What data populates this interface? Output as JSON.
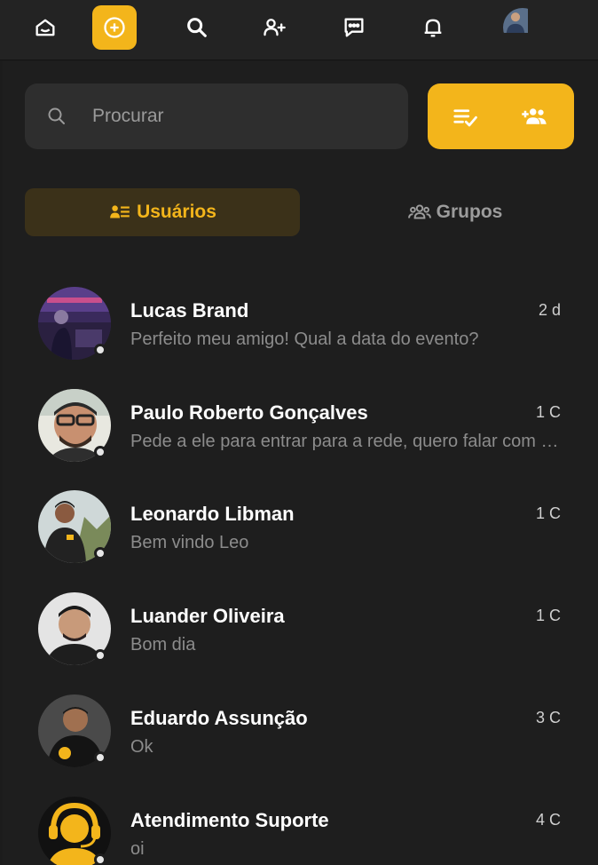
{
  "colors": {
    "accent": "#f3b51b",
    "background": "#1e1e1e",
    "topbar": "#232323",
    "muted_text": "#8c8c8c"
  },
  "topbar": {
    "items": [
      {
        "icon": "home-icon"
      },
      {
        "icon": "plus-circle-icon",
        "active": true
      },
      {
        "icon": "search-icon"
      },
      {
        "icon": "add-user-icon"
      },
      {
        "icon": "chat-icon"
      },
      {
        "icon": "bell-icon"
      },
      {
        "icon": "profile-avatar"
      }
    ]
  },
  "search": {
    "placeholder": "Procurar"
  },
  "actions": {
    "icons": [
      "mark-read-icon",
      "group-add-icon"
    ]
  },
  "tabs": [
    {
      "label": "Usuários",
      "icon": "users-list-icon",
      "active": true
    },
    {
      "label": "Grupos",
      "icon": "groups-icon",
      "active": false
    }
  ],
  "conversations": [
    {
      "name": "Lucas Brand",
      "time": "2 d",
      "preview": "Perfeito meu amigo! Qual a data do evento?"
    },
    {
      "name": "Paulo Roberto Gonçalves",
      "time": "1 C",
      "preview": "Pede a ele para entrar para a rede, quero falar com ele"
    },
    {
      "name": "Leonardo Libman",
      "time": "1 C",
      "preview": "Bem vindo Leo"
    },
    {
      "name": "Luander Oliveira",
      "time": "1 C",
      "preview": "Bom dia"
    },
    {
      "name": "Eduardo Assunção",
      "time": "3 C",
      "preview": "Ok"
    },
    {
      "name": "Atendimento Suporte",
      "time": "4 C",
      "preview": "oi"
    }
  ]
}
